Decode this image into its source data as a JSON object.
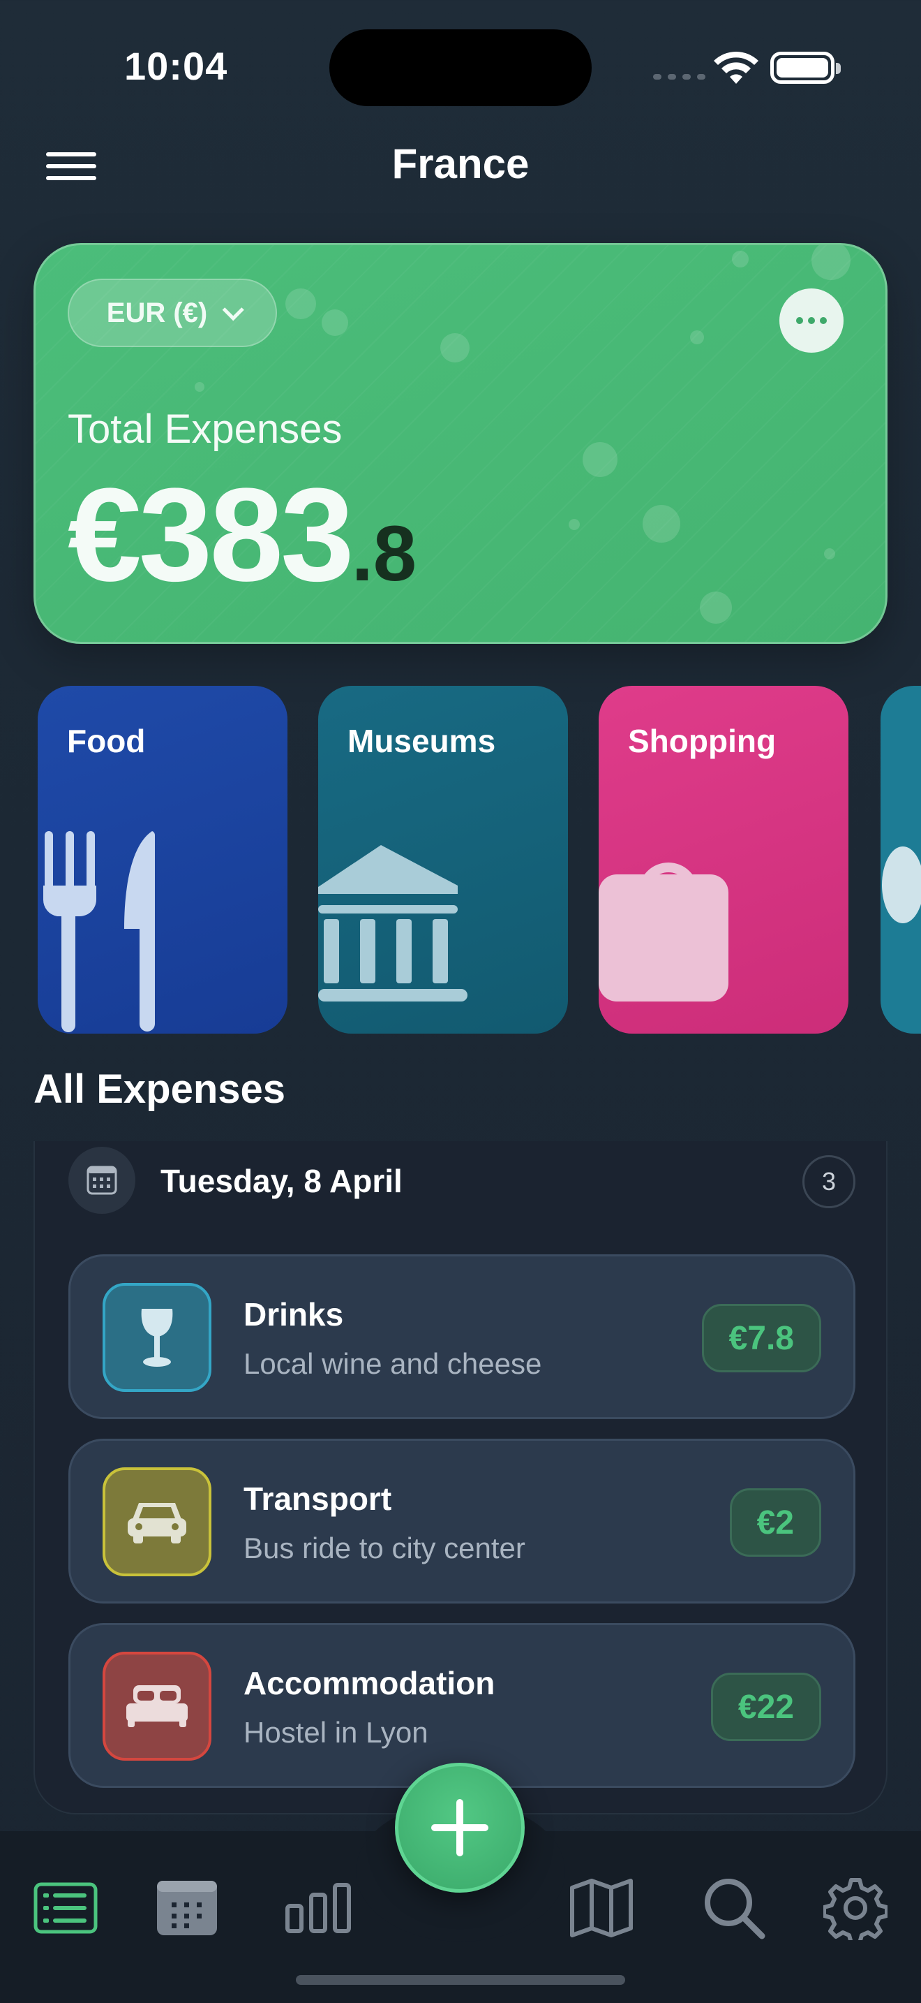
{
  "status_bar": {
    "time": "10:04"
  },
  "header": {
    "title": "France"
  },
  "summary": {
    "currency": "EUR (€)",
    "label": "Total Expenses",
    "amount_whole": "€383",
    "amount_decimal": ".8",
    "accent_color": "#47b674"
  },
  "categories": [
    {
      "label": "Food",
      "icon": "fork-knife-icon",
      "color": "#1c44a0"
    },
    {
      "label": "Museums",
      "icon": "museum-icon",
      "color": "#15637a"
    },
    {
      "label": "Shopping",
      "icon": "shopping-bag-icon",
      "color": "#d63582"
    }
  ],
  "expenses": {
    "section_title": "All Expenses",
    "groups": [
      {
        "date": "Tuesday, 8 April",
        "count": "3",
        "items": [
          {
            "title": "Drinks",
            "subtitle": "Local wine and cheese",
            "amount": "€7.8",
            "icon": "wine-glass-icon",
            "color": "#2b6f86"
          },
          {
            "title": "Transport",
            "subtitle": "Bus ride to city center",
            "amount": "€2",
            "icon": "car-icon",
            "color": "#7d7a3a"
          },
          {
            "title": "Accommodation",
            "subtitle": "Hostel in Lyon",
            "amount": "€22",
            "icon": "bed-icon",
            "color": "#8e4444"
          }
        ]
      }
    ]
  },
  "tabbar": {
    "items": [
      "list-icon",
      "calendar-icon",
      "stats-icon",
      "map-icon",
      "search-icon",
      "settings-icon"
    ],
    "active": "list-icon",
    "active_color": "#4bc47e"
  }
}
